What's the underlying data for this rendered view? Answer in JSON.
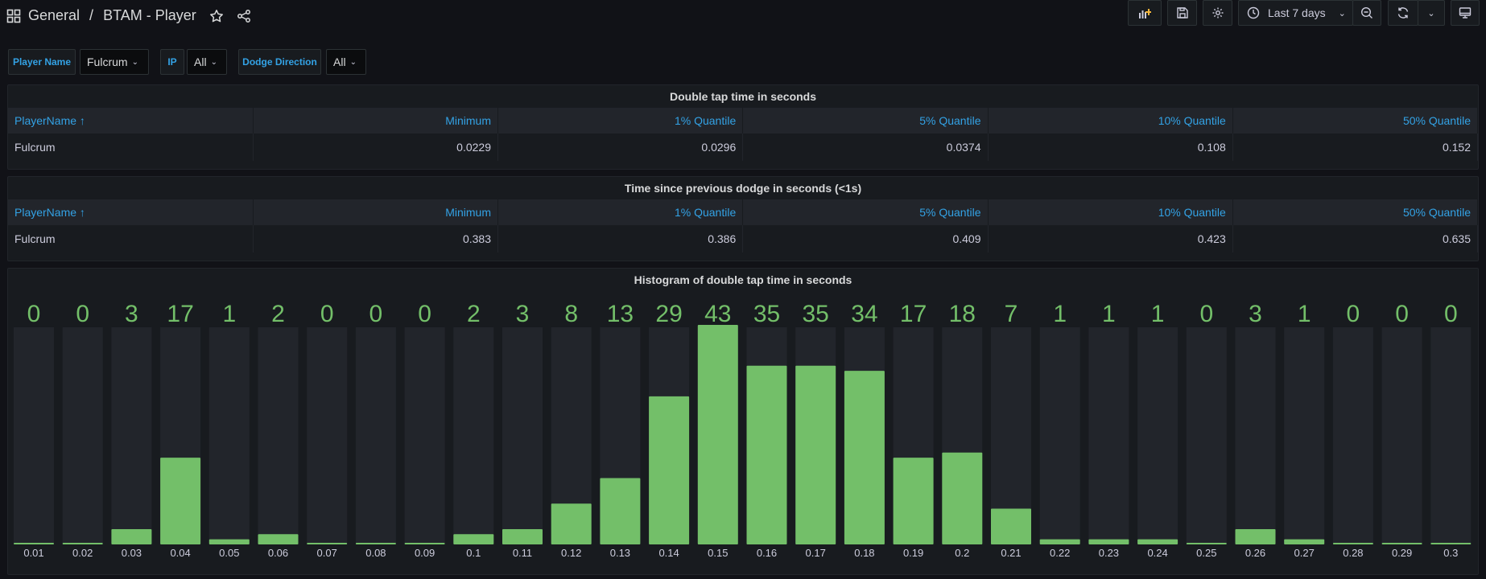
{
  "breadcrumb": {
    "folder": "General",
    "separator": "/",
    "dashboard": "BTAM - Player"
  },
  "toolbar": {
    "time_range": "Last 7 days"
  },
  "variables": [
    {
      "label": "Player Name",
      "value": "Fulcrum"
    },
    {
      "label": "IP",
      "value": "All"
    },
    {
      "label": "Dodge Direction",
      "value": "All"
    }
  ],
  "panels": {
    "double_tap": {
      "title": "Double tap time in seconds",
      "columns": [
        "PlayerName ↑",
        "Minimum",
        "1% Quantile",
        "5% Quantile",
        "10% Quantile",
        "50% Quantile"
      ],
      "rows": [
        [
          "Fulcrum",
          "0.0229",
          "0.0296",
          "0.0374",
          "0.108",
          "0.152"
        ]
      ]
    },
    "prev_dodge": {
      "title": "Time since previous dodge in seconds (<1s)",
      "columns": [
        "PlayerName ↑",
        "Minimum",
        "1% Quantile",
        "5% Quantile",
        "10% Quantile",
        "50% Quantile"
      ],
      "rows": [
        [
          "Fulcrum",
          "0.383",
          "0.386",
          "0.409",
          "0.423",
          "0.635"
        ]
      ]
    },
    "histogram": {
      "title": "Histogram of double tap time in seconds"
    }
  },
  "chart_data": {
    "type": "bar",
    "title": "Histogram of double tap time in seconds",
    "categories": [
      "0.01",
      "0.02",
      "0.03",
      "0.04",
      "0.05",
      "0.06",
      "0.07",
      "0.08",
      "0.09",
      "0.1",
      "0.11",
      "0.12",
      "0.13",
      "0.14",
      "0.15",
      "0.16",
      "0.17",
      "0.18",
      "0.19",
      "0.2",
      "0.21",
      "0.22",
      "0.23",
      "0.24",
      "0.25",
      "0.26",
      "0.27",
      "0.28",
      "0.29",
      "0.3"
    ],
    "values": [
      0,
      0,
      3,
      17,
      1,
      2,
      0,
      0,
      0,
      2,
      3,
      8,
      13,
      29,
      43,
      35,
      35,
      34,
      17,
      18,
      7,
      1,
      1,
      1,
      0,
      3,
      1,
      0,
      0,
      0
    ],
    "ylim": [
      0,
      43
    ],
    "bar_color": "#73bf69",
    "track_color": "#22252b",
    "value_color": "#73bf69"
  },
  "colors": {
    "accent": "#33a2e5",
    "background": "#111217",
    "panel": "#181b1f"
  }
}
